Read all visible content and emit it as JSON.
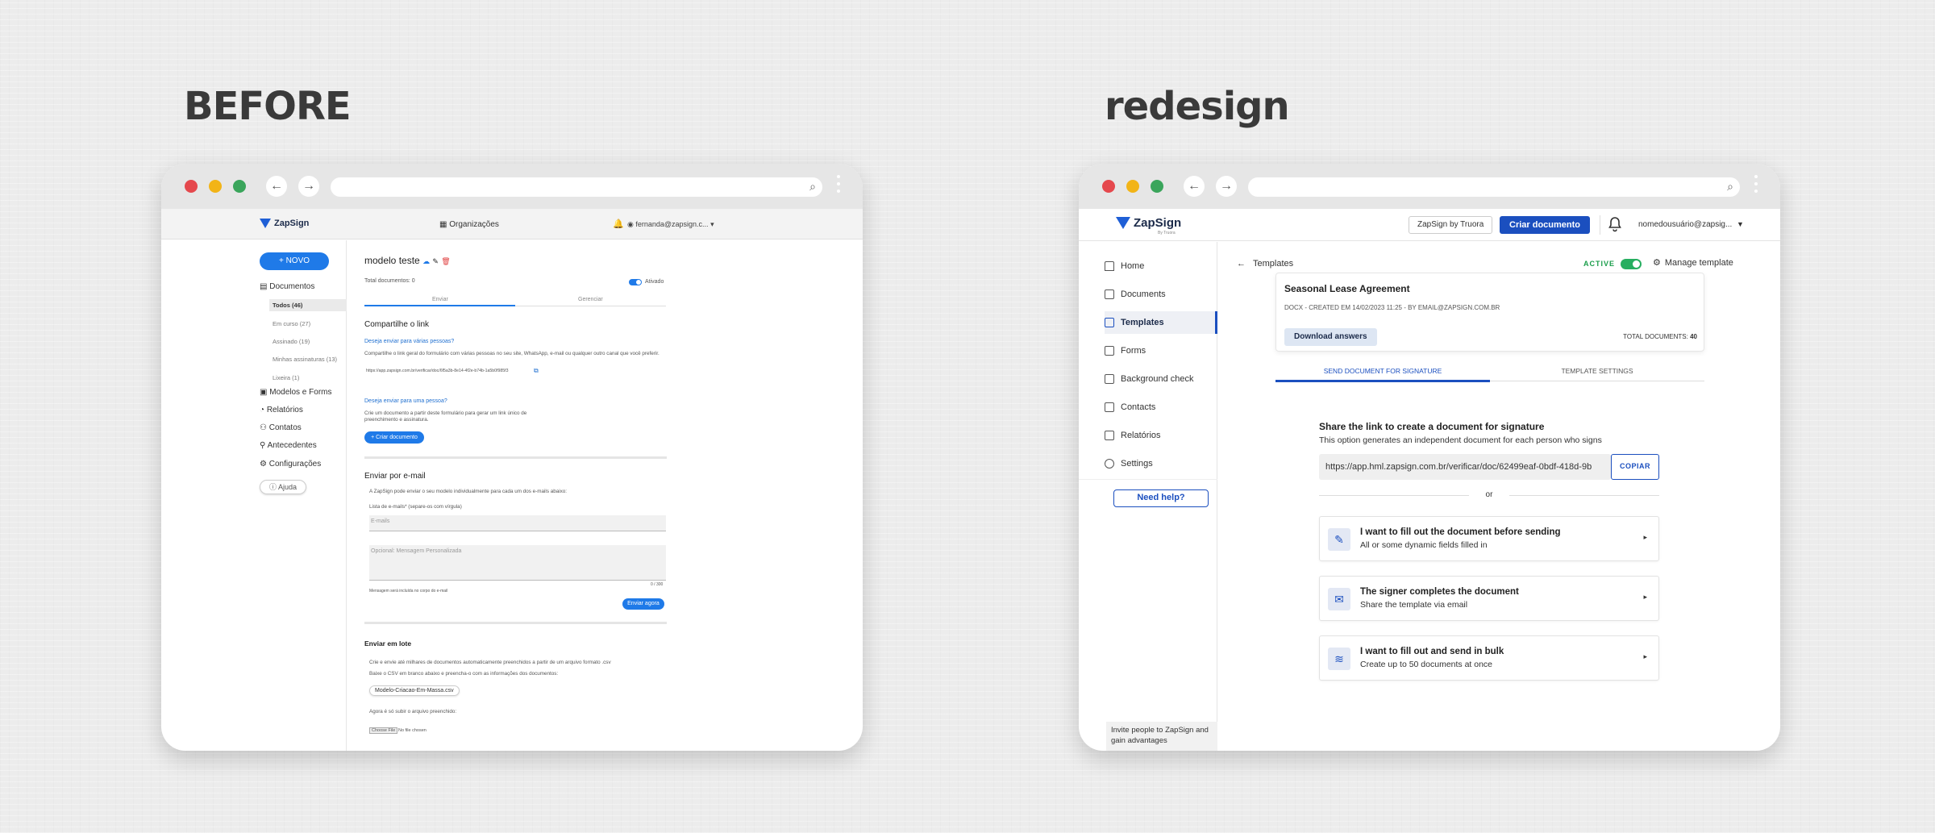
{
  "headings": {
    "before": "BEFORE",
    "after": "redesign"
  },
  "before": {
    "logo": "ZapSign",
    "org": "Organizações",
    "user": "fernanda@zapsign.c...",
    "new_button": "+ NOVO",
    "nav": {
      "documents": "Documentos",
      "sub": [
        "Todos (46)",
        "Em curso (27)",
        "Assinado (19)",
        "Minhas assinaturas (13)",
        "Lixeira (1)"
      ],
      "models": "Modelos e Forms",
      "reports": "Relatórios",
      "contacts": "Contatos",
      "background": "Antecedentes",
      "settings": "Configurações",
      "help": "Ajuda"
    },
    "title": "modelo teste",
    "total_docs": "Total documentos: 0",
    "toggle_label": "Ativado",
    "tabs": [
      "Enviar",
      "Gerenciar"
    ],
    "share_link": {
      "heading": "Compartilhe o link",
      "q1": "Deseja enviar para várias pessoas?",
      "desc1": "Compartilhe o link geral do formulário com várias pessoas no seu site, WhatsApp, e-mail ou qualquer outro canal que você preferir.",
      "url": "https://app.zapsign.com.br/verificar/doc/6f5a3b-8e14-4f2e-b74b-1a5b0f985f3",
      "q2": "Deseja enviar para uma pessoa?",
      "desc2": "Crie um documento a partir deste formulário para gerar um link único de preenchimento e assinatura.",
      "create_doc": "+ Criar documento"
    },
    "email": {
      "heading": "Enviar por e-mail",
      "desc": "A ZapSign pode enviar o seu modelo individualmente para cada um dos e-mails abaixo:",
      "list_label": "Lista de e-mails* (separe-os com vírgula)",
      "email_placeholder": "E-mails",
      "message_placeholder": "Opcional: Mensagem Personalizada",
      "counter": "0 / 300",
      "note": "Mensagem será incluída no corpo do e-mail",
      "send_now": "Enviar agora"
    },
    "bulk": {
      "heading": "Enviar em lote",
      "desc1": "Crie e envie até milhares de documentos automaticamente preenchidos a partir de um arquivo formato .csv",
      "desc2": "Baixe o CSV em branco abaixo e preencha-o com as informações dos documentos:",
      "file_button": "Modelo-Criacao-Em-Massa.csv",
      "upload_label": "Agora é só subir o arquivo preenchido:",
      "choose_file": "Choose File",
      "no_file": "No file chosen"
    }
  },
  "after": {
    "logo": "ZapSign",
    "logo_sub": "By Truora",
    "zapsign_truora": "ZapSign by Truora",
    "create_doc": "Criar documento",
    "user": "nomedousuário@zapsig...",
    "nav": [
      "Home",
      "Documents",
      "Templates",
      "Forms",
      "Background check",
      "Contacts",
      "Relatórios",
      "Settings"
    ],
    "need_help": "Need help?",
    "invite": "Invite people to ZapSign and gain advantages",
    "back_label": "Templates",
    "active": "ACTIVE",
    "manage": "Manage template",
    "card": {
      "title": "Seasonal Lease Agreement",
      "meta": "DOCX - CREATED EM 14/02/2023 11:25 - BY EMAIL@ZAPSIGN.COM.BR",
      "download": "Download answers",
      "total_label": "TOTAL DOCUMENTS:",
      "total_value": "40"
    },
    "tabs": [
      "SEND DOCUMENT FOR SIGNATURE",
      "TEMPLATE SETTINGS"
    ],
    "share_title": "Share the link to create a document for signature",
    "share_sub": "This option generates an independent document for each person who signs",
    "share_url": "https://app.hml.zapsign.com.br/verificar/doc/62499eaf-0bdf-418d-9b",
    "copy": "COPIAR",
    "or": "or",
    "options": [
      {
        "title": "I want to fill out the document before sending",
        "sub": "All or some dynamic fields filled in",
        "icon": "pencil-icon"
      },
      {
        "title": "The signer completes the document",
        "sub": "Share the template via email",
        "icon": "mail-icon"
      },
      {
        "title": "I want to fill out and send in bulk",
        "sub": "Create up to 50 documents at once",
        "icon": "layers-icon"
      }
    ]
  }
}
